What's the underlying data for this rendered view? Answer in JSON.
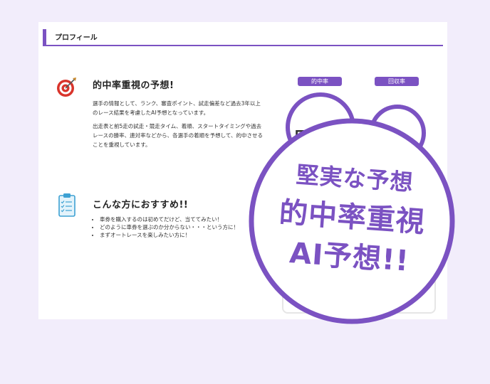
{
  "profile": {
    "header_title": "プロフィール"
  },
  "section_prediction": {
    "title": "的中率重視の予想!",
    "paragraph1": "選手の情報として、ランク、審査ポイント、試走偏差など過去3年以上のレース結果を考慮したAI予想となっています。",
    "paragraph2": "出走表と前5走の試走・競走タイム、着順、スタートタイミングや過去レースの勝率、連対率などから、各選手の着順を予想して、的中させることを重視しています。"
  },
  "section_recommend": {
    "title": "こんな方におすすめ!!",
    "items": [
      "車券を購入するのは初めてだけど、当ててみたい！",
      "どのように車券を選ぶのか分からない・・・という方に！",
      "まずオートレースを楽しみたい方に！"
    ]
  },
  "stats": {
    "hit_rate_label": "的中率",
    "recovery_rate_label": "回収率",
    "hit_rate_partial_value": "5"
  },
  "badge": {
    "line1": "堅実な予想",
    "line2": "的中率重視",
    "line3": "AI予想!!"
  },
  "colors": {
    "accent": "#7b52c2",
    "background": "#f2edfb"
  },
  "icons": [
    "target-icon",
    "clipboard-checklist-icon"
  ]
}
